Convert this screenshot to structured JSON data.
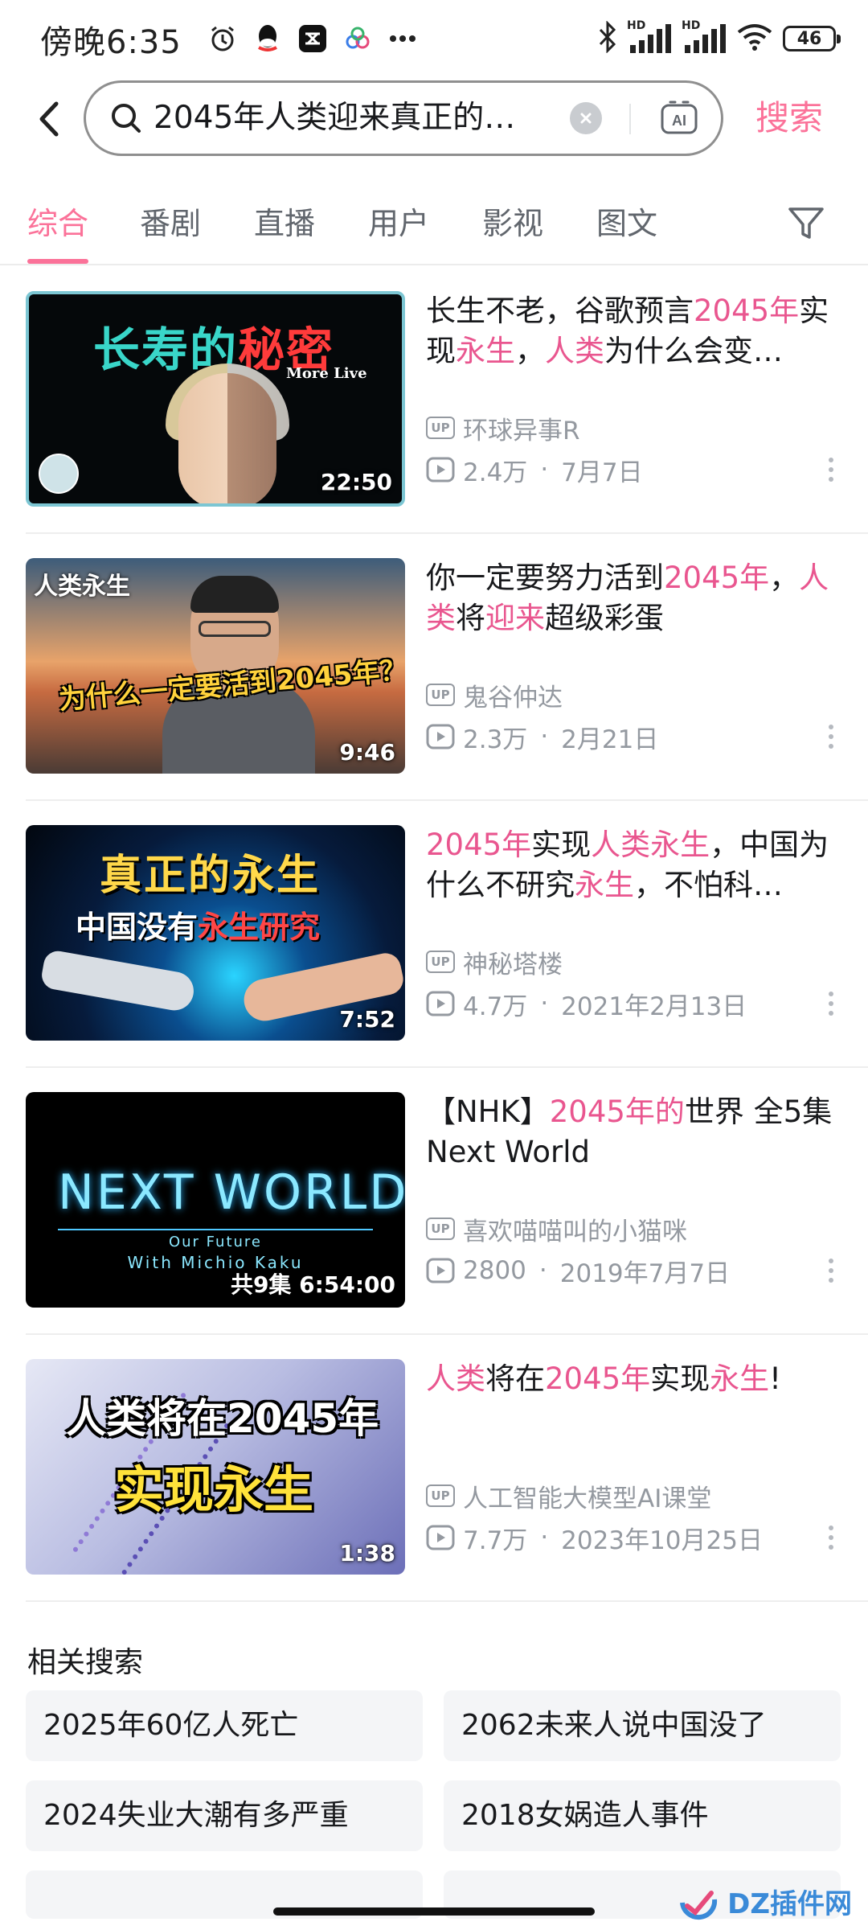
{
  "status_bar": {
    "time": "傍晚6:35",
    "battery": "46",
    "network_1": "HD",
    "network_2": "HD"
  },
  "search": {
    "query": "2045年人类迎来真正的…",
    "submit_label": "搜索",
    "ai_label": "AI"
  },
  "tabs": [
    {
      "label": "综合",
      "active": true
    },
    {
      "label": "番剧"
    },
    {
      "label": "直播"
    },
    {
      "label": "用户"
    },
    {
      "label": "影视"
    },
    {
      "label": "图文"
    }
  ],
  "up_badge": "UP",
  "results": [
    {
      "title_parts": [
        {
          "text": "长生不老，谷歌预言"
        },
        {
          "text": "2045年",
          "hl": true
        },
        {
          "text": "实现"
        },
        {
          "text": "永生",
          "hl": true
        },
        {
          "text": "，"
        },
        {
          "text": "人类",
          "hl": true
        },
        {
          "text": "为什么会变…"
        }
      ],
      "author": "环球异事R",
      "views": "2.4万",
      "date": "7月7日",
      "duration": "22:50",
      "thumb": {
        "title_a": "长寿的",
        "title_b": "秘密",
        "brand": "More Live"
      }
    },
    {
      "title_parts": [
        {
          "text": "你一定要努力活到"
        },
        {
          "text": "2045年",
          "hl": true
        },
        {
          "text": "，"
        },
        {
          "text": "人类",
          "hl": true
        },
        {
          "text": "将"
        },
        {
          "text": "迎来",
          "hl": true
        },
        {
          "text": "超级彩蛋"
        }
      ],
      "author": "鬼谷仲达",
      "views": "2.3万",
      "date": "2月21日",
      "duration": "9:46",
      "thumb": {
        "label": "人类永生",
        "caption": "为什么一定要活到2045年？"
      }
    },
    {
      "title_parts": [
        {
          "text": "2045年",
          "hl": true
        },
        {
          "text": "实现"
        },
        {
          "text": "人类永生",
          "hl": true
        },
        {
          "text": "，中国为什么不研究"
        },
        {
          "text": "永生",
          "hl": true
        },
        {
          "text": "，不怕科…"
        }
      ],
      "author": "神秘塔楼",
      "views": "4.7万",
      "date": "2021年2月13日",
      "duration": "7:52",
      "thumb": {
        "line1": "真正的永生",
        "line2_a": "中国没有",
        "line2_b": "永生研究"
      }
    },
    {
      "title_parts": [
        {
          "text": "【NHK】"
        },
        {
          "text": "2045年的",
          "hl": true
        },
        {
          "text": "世界 全5集 Next World"
        }
      ],
      "author": "喜欢喵喵叫的小猫咪",
      "views": "2800",
      "date": "2019年7月7日",
      "duration": "共9集 6:54:00",
      "thumb": {
        "title": "NEXT WORLD",
        "sub1": "Our Future",
        "sub2": "With Michio Kaku"
      }
    },
    {
      "title_parts": [
        {
          "text": "人类",
          "hl": true
        },
        {
          "text": "将在"
        },
        {
          "text": "2045年",
          "hl": true
        },
        {
          "text": "实现"
        },
        {
          "text": "永生",
          "hl": true
        },
        {
          "text": "!"
        }
      ],
      "author": "人工智能大模型AI课堂",
      "views": "7.7万",
      "date": "2023年10月25日",
      "duration": "1:38",
      "thumb": {
        "line1": "人类将在2045年",
        "line2": "实现永生"
      }
    }
  ],
  "related": {
    "title": "相关搜索",
    "items": [
      "2025年60亿人死亡",
      "2062未来人说中国没了",
      "2024失业大潮有多严重",
      "2018女娲造人事件"
    ]
  },
  "watermark": {
    "text": "DZ插件网"
  },
  "colors": {
    "accent": "#fb7299",
    "highlight": "#e9568f",
    "secondary_text": "#9499a0",
    "chip_bg": "#f4f5f7"
  },
  "icons": [
    "back-arrow-icon",
    "search-icon",
    "clear-icon",
    "ai-icon",
    "filter-icon",
    "play-icon",
    "more-icon",
    "bluetooth-icon",
    "signal-icon",
    "wifi-icon",
    "battery-icon",
    "alarm-icon",
    "qq-icon"
  ]
}
